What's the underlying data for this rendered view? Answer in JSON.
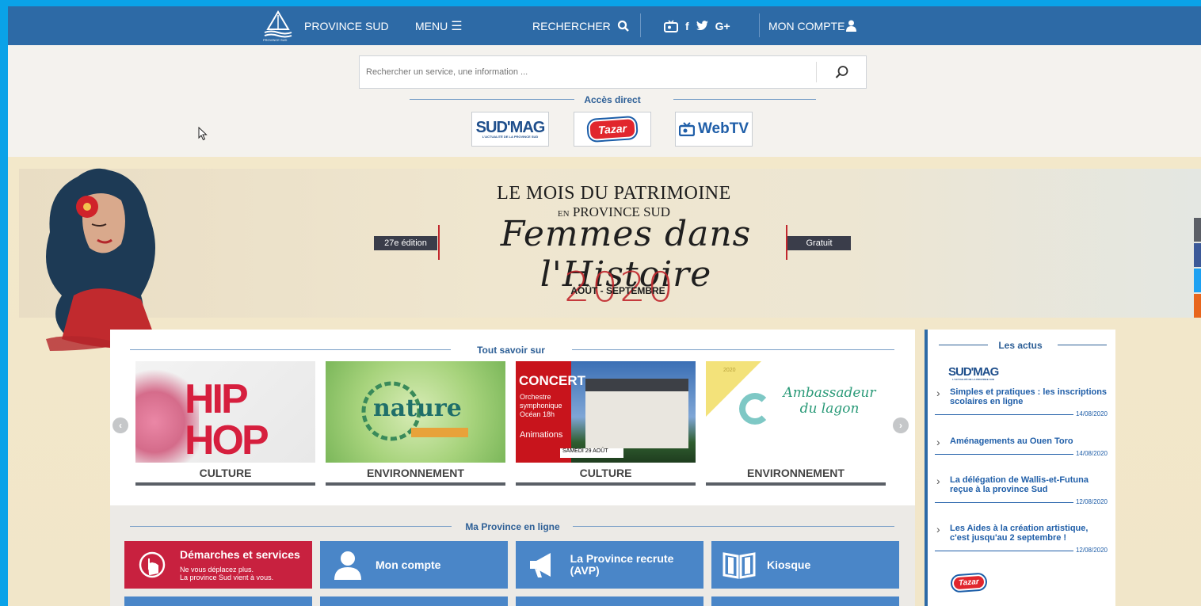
{
  "topbar": {
    "brand": "PROVINCE SUD",
    "menu": "MENU",
    "search": "RECHERCHER",
    "account": "MON COMPTE",
    "logo_sub": "PROVINCE SUD"
  },
  "search": {
    "placeholder": "Rechercher un service, une information ..."
  },
  "access": {
    "title": "Accès direct",
    "sudmag": "SUD'MAG",
    "sudmag_tag": "L'ACTUALITÉ DE LA PROVINCE SUD",
    "tazar": "Tazar",
    "webtv": "WebTV"
  },
  "banner": {
    "title": "LE MOIS DU PATRIMOINE",
    "en": "EN",
    "province": "PROVINCE SUD",
    "script": "Femmes dans l'Histoire",
    "edition": "27e édition",
    "gratuit": "Gratuit",
    "year": "2020",
    "months": "AOÛT - SEPTEMBRE"
  },
  "tout_savoir": {
    "title": "Tout savoir sur",
    "cards": [
      {
        "label": "CULTURE",
        "art": "HIP HOP"
      },
      {
        "label": "ENVIRONNEMENT",
        "art": "nature"
      },
      {
        "label": "CULTURE",
        "art": "CONCERT",
        "art_sub": "Orchestre symphonique Océan 18h",
        "art_anim": "Animations",
        "art_date": "SAMEDI 29 AOÛT"
      },
      {
        "label": "ENVIRONNEMENT",
        "art": "Ambassadeur du lagon",
        "art_sub": "2020"
      }
    ]
  },
  "ma_province": {
    "title": "Ma Province en ligne",
    "tiles": [
      {
        "label": "Démarches et services",
        "sub1": "Ne vous déplacez plus.",
        "sub2": "La province Sud vient à vous."
      },
      {
        "label": "Mon compte"
      },
      {
        "label": "La Province recrute (AVP)"
      },
      {
        "label": "Kiosque"
      }
    ]
  },
  "actus": {
    "title": "Les actus",
    "source": "SUD'MAG",
    "items": [
      {
        "title": "Simples et pratiques : les inscriptions scolaires en ligne",
        "date": "14/08/2020"
      },
      {
        "title": "Aménagements au Ouen Toro",
        "date": "14/08/2020"
      },
      {
        "title": "La délégation de Wallis-et-Futuna reçue à la province Sud",
        "date": "12/08/2020"
      },
      {
        "title": "Les Aides à la création artistique, c'est jusqu'au 2 septembre !",
        "date": "12/08/2020"
      }
    ],
    "source2": "Tazar"
  },
  "colors": {
    "topbar": "#2d6aa6",
    "tile": "#4a86c8",
    "accent_red": "#c1272d",
    "desktop": "#0aa2e8"
  }
}
